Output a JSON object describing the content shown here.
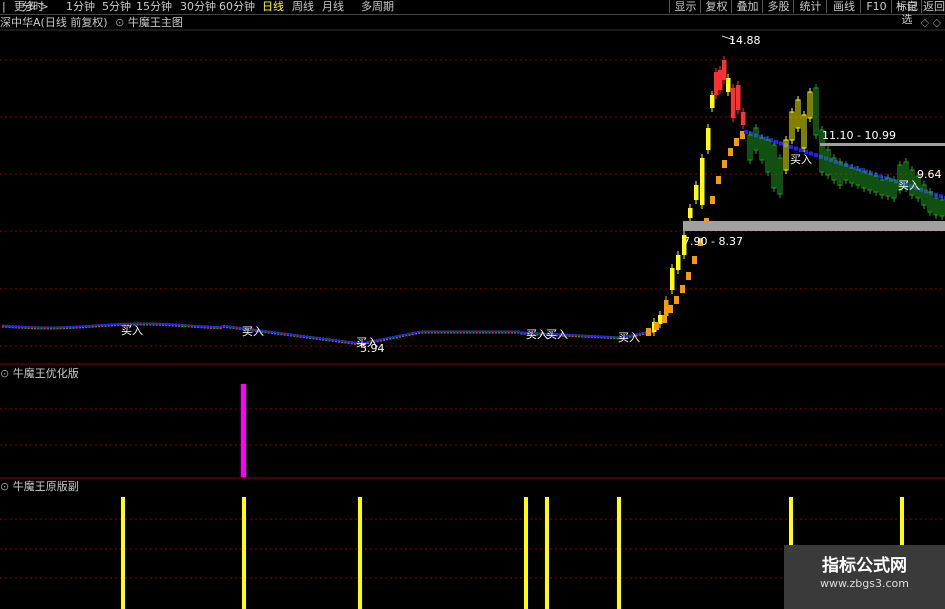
{
  "toolbar": {
    "left_icon": "|",
    "periods": [
      "分时",
      "1分钟",
      "5分钟",
      "15分钟",
      "30分钟",
      "60分钟",
      "日线",
      "周线",
      "月线",
      "多周期",
      "更多 >"
    ],
    "active_period": "日线",
    "buttons": [
      "显示",
      "复权",
      "叠加",
      "多股",
      "统计",
      "画线",
      "F10",
      "标记",
      "+自选",
      "返回"
    ]
  },
  "main_panel": {
    "stock_title": "深中华A(日线 前复权)",
    "indicator_title": "牛魔王主图",
    "collapse_icon": "chevron-down-circle-icon",
    "corner_icons": [
      "◇",
      "◇"
    ],
    "peak_label": "14.88",
    "low_label": "5.94",
    "resistance_label": "11.10 - 10.99",
    "support_label": "7.90 - 8.37",
    "right_label": "9.64 -",
    "buy_label": "买入"
  },
  "sub_panel_1": {
    "title": "牛魔王优化版"
  },
  "sub_panel_2": {
    "title": "牛魔王原版副"
  },
  "watermark": {
    "line1": "指标公式网",
    "line2": "www.zbgs3.com"
  },
  "colors": {
    "up": "#ff3030",
    "down": "#20a020",
    "line_blue": "#2020ff",
    "line_orange": "#ff9900",
    "signal_yellow": "#ffff00",
    "signal_magenta": "#ff00ff",
    "grid": "#8b0000",
    "band": "#a0a0a0"
  },
  "chart_data": [
    {
      "type": "candlestick",
      "title": "牛魔王主图",
      "annotations": [
        {
          "text": "14.88",
          "kind": "peak"
        },
        {
          "text": "5.94",
          "kind": "low"
        },
        {
          "text": "11.10 - 10.99",
          "kind": "resistance band"
        },
        {
          "text": "7.90 - 8.37",
          "kind": "support band"
        },
        {
          "text": "9.64 -",
          "kind": "level"
        }
      ],
      "buy_signal_count": 9,
      "approx_price_range": [
        5.94,
        14.88
      ]
    },
    {
      "type": "bar",
      "title": "牛魔王优化版",
      "signals": [
        {
          "position": "single spike",
          "color": "magenta",
          "value": 1
        }
      ]
    },
    {
      "type": "bar",
      "title": "牛魔王原版副",
      "signals_count": 9,
      "color": "yellow"
    }
  ]
}
